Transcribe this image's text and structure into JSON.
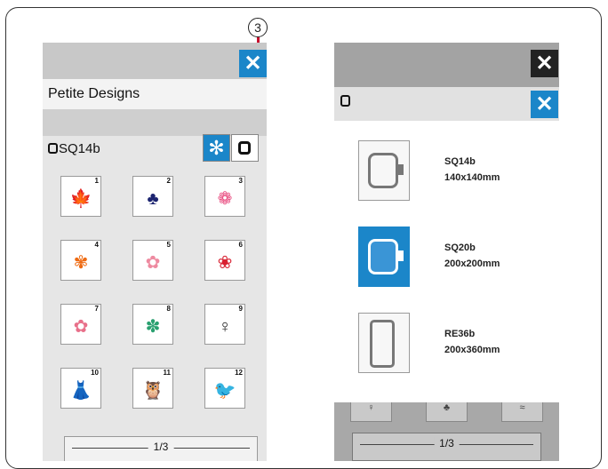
{
  "callout": {
    "number": "3"
  },
  "left_screen": {
    "close_label": "✕",
    "title": "Petite Designs",
    "hoop_label": "SQ14b",
    "design_mode_icon": "✻",
    "designs": [
      {
        "num": "1",
        "glyph": "🍁",
        "color": "#b0141c",
        "icon": "maple-leaf-icon"
      },
      {
        "num": "2",
        "glyph": "♣",
        "color": "#1c2470",
        "icon": "ornament-icon"
      },
      {
        "num": "3",
        "glyph": "❁",
        "color": "#e8467c",
        "icon": "lace-flower-icon"
      },
      {
        "num": "4",
        "glyph": "✾",
        "color": "#ee6a12",
        "icon": "orange-flower-icon"
      },
      {
        "num": "5",
        "glyph": "✿",
        "color": "#ee8aa0",
        "icon": "blossom-icon"
      },
      {
        "num": "6",
        "glyph": "❀",
        "color": "#d82030",
        "icon": "red-flower-icon"
      },
      {
        "num": "7",
        "glyph": "✿",
        "color": "#e8708a",
        "icon": "pink-flower-icon"
      },
      {
        "num": "8",
        "glyph": "✽",
        "color": "#2aa070",
        "icon": "pinwheel-flower-icon"
      },
      {
        "num": "9",
        "glyph": "♀",
        "color": "#222222",
        "icon": "ballerina-icon"
      },
      {
        "num": "10",
        "glyph": "👗",
        "color": "#e8447c",
        "icon": "dress-form-icon"
      },
      {
        "num": "11",
        "glyph": "🦉",
        "color": "#6a4a2a",
        "icon": "owl-icon"
      },
      {
        "num": "12",
        "glyph": "🐦",
        "color": "#2a98c8",
        "icon": "bird-icon"
      }
    ],
    "page_indicator": "1/3"
  },
  "right_screen": {
    "close_label": "✕",
    "hoops": [
      {
        "name": "SQ14b",
        "size": "140x140mm",
        "selected": false,
        "icon": "square-hoop-icon"
      },
      {
        "name": "SQ20b",
        "size": "200x200mm",
        "selected": true,
        "icon": "square-hoop-icon"
      },
      {
        "name": "RE36b",
        "size": "200x360mm",
        "selected": false,
        "icon": "rectangle-hoop-icon"
      }
    ],
    "page_indicator": "1/3"
  }
}
